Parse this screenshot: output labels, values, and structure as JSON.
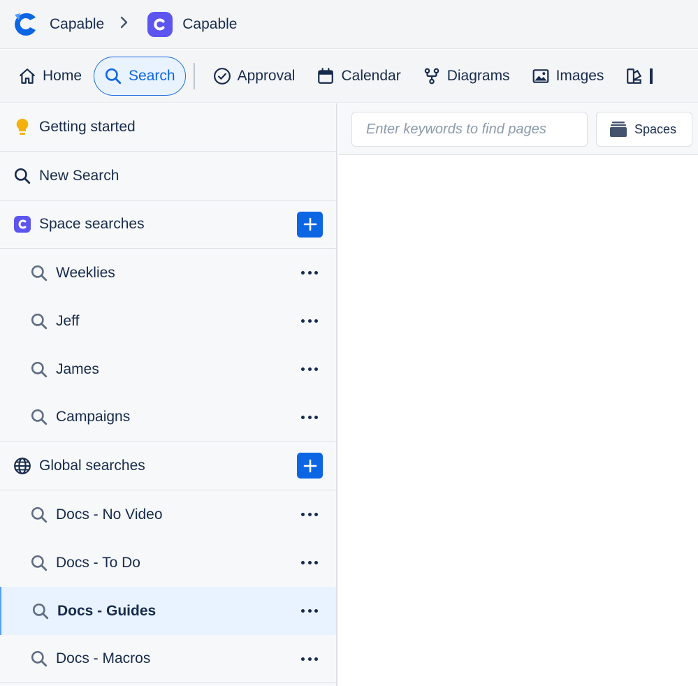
{
  "breadcrumb": {
    "app_name": "Capable",
    "space_name": "Capable"
  },
  "nav": {
    "items": [
      {
        "label": "Home",
        "icon": "home-icon"
      },
      {
        "label": "Search",
        "icon": "search-icon",
        "active": true
      },
      {
        "label": "Approval",
        "icon": "check-circle-icon"
      },
      {
        "label": "Calendar",
        "icon": "calendar-icon"
      },
      {
        "label": "Diagrams",
        "icon": "diagram-branch-icon"
      },
      {
        "label": "Images",
        "icon": "image-icon"
      }
    ]
  },
  "sidebar": {
    "getting_started": "Getting started",
    "new_search": "New Search",
    "space_searches": {
      "title": "Space searches",
      "items": [
        "Weeklies",
        "Jeff",
        "James",
        "Campaigns"
      ]
    },
    "global_searches": {
      "title": "Global searches",
      "items": [
        "Docs - No Video",
        "Docs - To Do",
        "Docs - Guides",
        "Docs - Macros"
      ],
      "selected": "Docs - Guides"
    }
  },
  "main": {
    "search_placeholder": "Enter keywords to find pages",
    "spaces_label": "Spaces"
  },
  "colors": {
    "accent": "#0c66e4",
    "selected_bg": "#e9f2ff",
    "space_logo": "#5d55f0"
  }
}
